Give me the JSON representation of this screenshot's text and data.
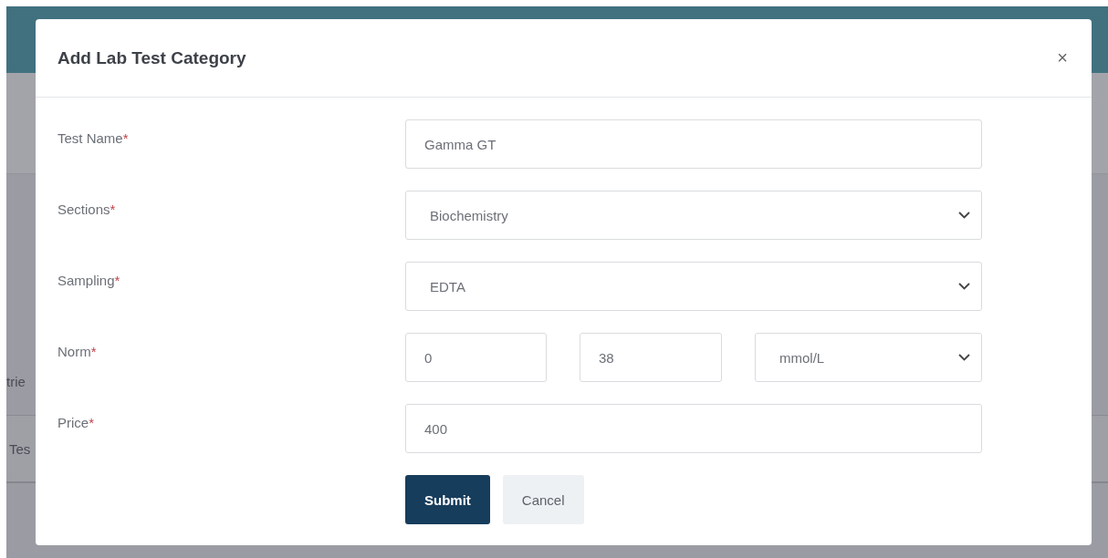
{
  "background": {
    "entries_text": "trie",
    "table_header": "Tes"
  },
  "dialog": {
    "title": "Add Lab Test Category",
    "close": "×",
    "fields": [
      {
        "kind": "input",
        "label": "Test Name",
        "required_mark": "*",
        "value": "Gamma GT"
      },
      {
        "kind": "select",
        "label": "Sections",
        "required_mark": "*",
        "value": "Biochemistry"
      },
      {
        "kind": "select",
        "label": "Sampling",
        "required_mark": "*",
        "value": "EDTA"
      },
      {
        "kind": "range",
        "label": "Norm",
        "required_mark": "*",
        "min": "0",
        "max": "38",
        "unit": "mmol/L"
      },
      {
        "kind": "input",
        "label": "Price",
        "required_mark": "*",
        "value": "400"
      }
    ],
    "buttons": [
      {
        "label": "Submit",
        "kind": "primary"
      },
      {
        "label": "Cancel",
        "kind": "secondary"
      }
    ]
  }
}
